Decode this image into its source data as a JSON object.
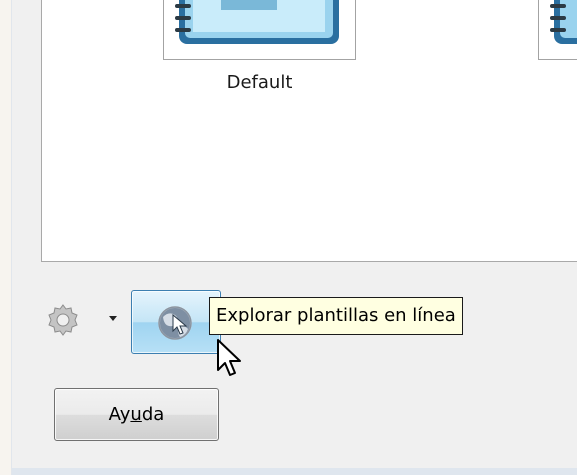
{
  "template_list": {
    "items": [
      {
        "label": "Default",
        "icon": "notebook-icon"
      },
      {
        "label": "",
        "icon": "notebook-icon"
      }
    ]
  },
  "toolbar": {
    "options_icon": "gear-icon",
    "browse_icon": "globe-icon",
    "tooltip": "Explorar plantillas en línea"
  },
  "help_button": {
    "label_before": "Ay",
    "label_mnemonic": "u",
    "label_after": "da"
  },
  "colors": {
    "accent": "#3c7fb1",
    "tooltip_bg": "#ffffe1",
    "dialog_bg": "#f0f0f0"
  }
}
